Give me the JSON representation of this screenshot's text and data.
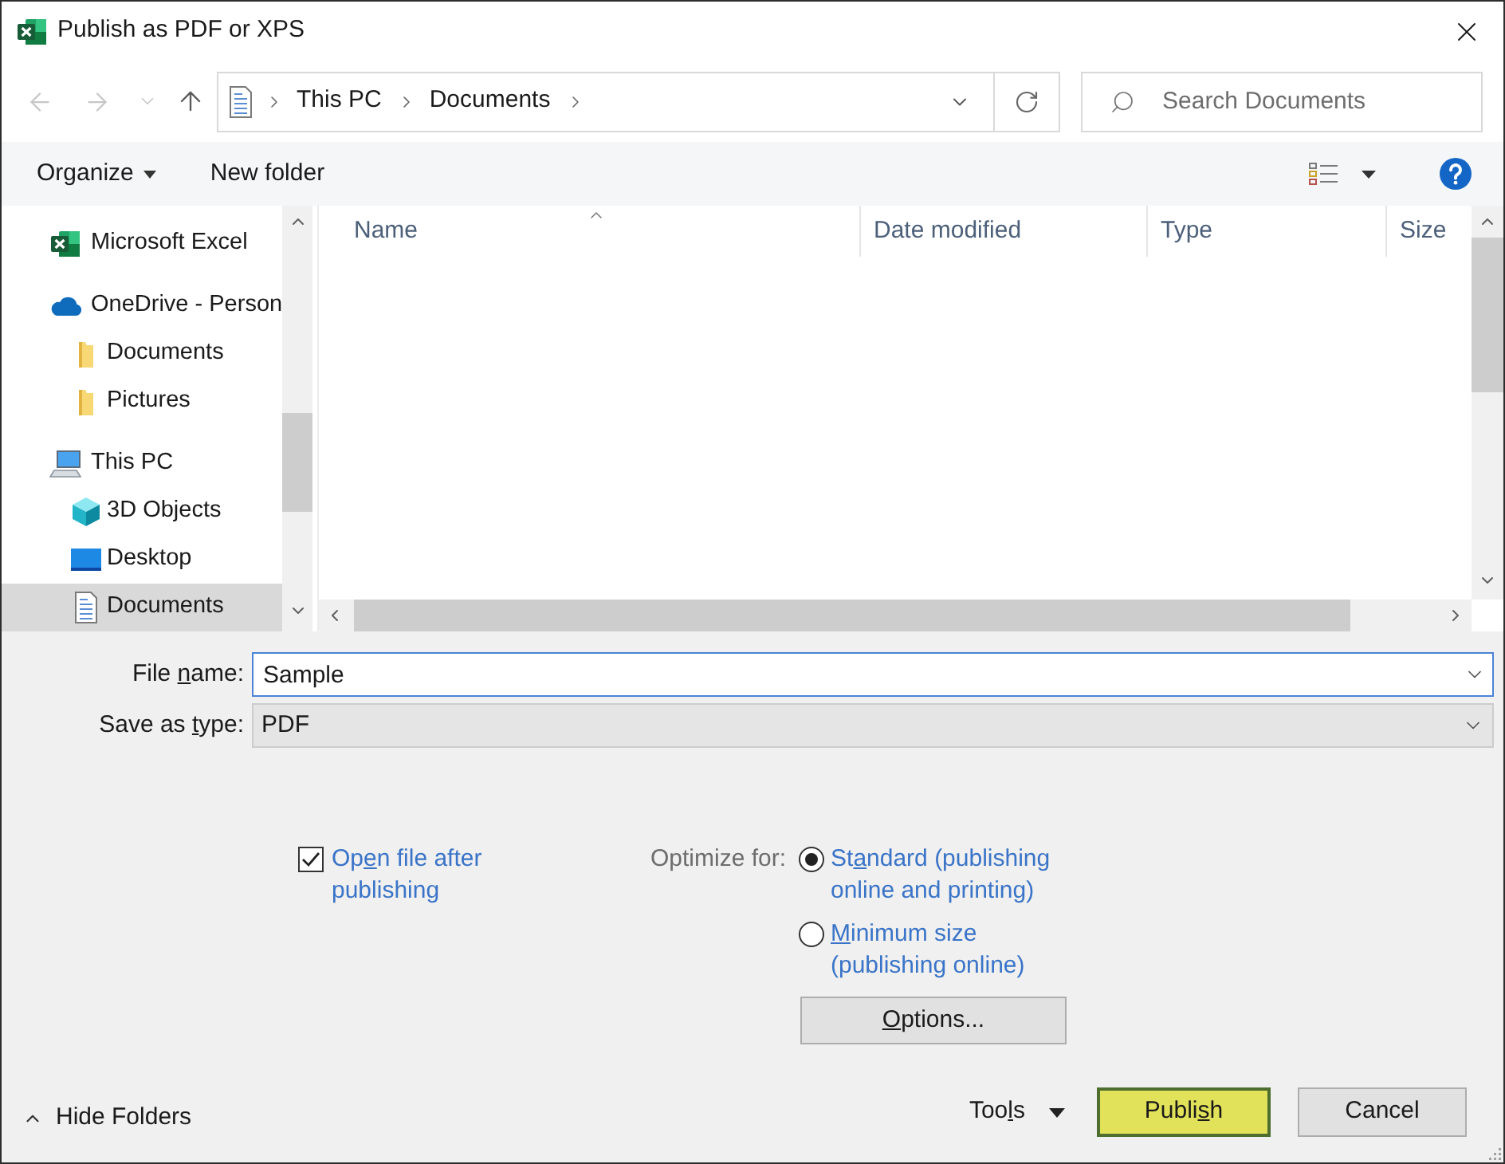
{
  "window": {
    "title": "Publish as PDF or XPS"
  },
  "nav_buttons": [
    {
      "kind": "back",
      "disabled": true
    },
    {
      "kind": "forward",
      "disabled": true
    },
    {
      "kind": "recent",
      "disabled": true
    },
    {
      "kind": "up",
      "disabled": false
    }
  ],
  "address_bar": {
    "breadcrumbs": [
      "This PC",
      "Documents"
    ]
  },
  "search": {
    "placeholder": "Search Documents"
  },
  "toolbar": {
    "organize": "Organize",
    "new_folder": "New folder"
  },
  "sidebar": {
    "items": [
      {
        "label": "Microsoft Excel",
        "kind": "excel",
        "selected": false
      },
      {
        "label": "OneDrive - Person",
        "kind": "cloud",
        "selected": false,
        "children": [
          {
            "label": "Documents",
            "kind": "folder",
            "selected": false
          },
          {
            "label": "Pictures",
            "kind": "folder",
            "selected": false
          }
        ]
      },
      {
        "label": "This PC",
        "kind": "computer",
        "selected": false,
        "children": [
          {
            "label": "3D Objects",
            "kind": "cube",
            "selected": false
          },
          {
            "label": "Desktop",
            "kind": "desktop",
            "selected": false
          },
          {
            "label": "Documents",
            "kind": "document",
            "selected": true
          }
        ]
      }
    ]
  },
  "file_list": {
    "columns": [
      {
        "label": "Name",
        "sorted": true
      },
      {
        "label": "Date modified",
        "sorted": false
      },
      {
        "label": "Type",
        "sorted": false
      },
      {
        "label": "Size",
        "sorted": false
      }
    ]
  },
  "file_name": {
    "label": {
      "before": "File ",
      "key": "n",
      "after": "ame:"
    },
    "value": "Sample"
  },
  "save_as_type": {
    "label": {
      "before": "Save as ",
      "key": "t",
      "after": "ype:"
    },
    "value": "PDF"
  },
  "open_after_publishing": {
    "label": {
      "before": "Op",
      "key": "e",
      "after": "n file after publishing"
    },
    "checked": true
  },
  "optimize": {
    "label": "Optimize for:",
    "options": [
      {
        "label": {
          "before": "St",
          "key": "a",
          "after": "ndard (publishing online and printing)"
        },
        "selected": true
      },
      {
        "label": {
          "key": "M",
          "after": "inimum size (publishing online)"
        },
        "selected": false
      }
    ]
  },
  "options_button": {
    "key": "O",
    "after": "ptions..."
  },
  "footer": {
    "hide_folders": "Hide Folders",
    "tools": {
      "before": "Too",
      "key": "l",
      "after": "s"
    },
    "buttons": [
      {
        "kind": "default",
        "label": {
          "before": "Publi",
          "key": "s",
          "after": "h"
        }
      },
      {
        "kind": "normal",
        "label": {
          "before": "Cancel"
        }
      }
    ]
  }
}
